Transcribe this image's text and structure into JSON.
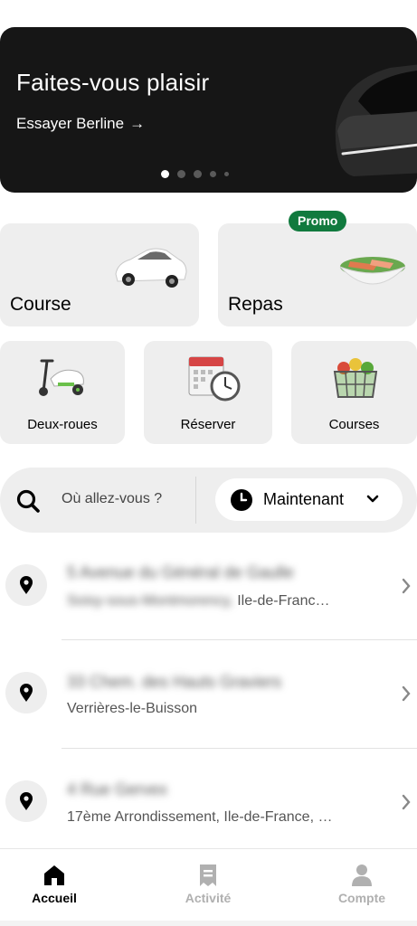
{
  "banner": {
    "title": "Faites-vous plaisir",
    "link": "Essayer Berline",
    "arrow": "→",
    "dots": 5,
    "active_dot": 0
  },
  "tiles": {
    "course": "Course",
    "repas": "Repas",
    "promo_badge": "Promo",
    "deux_roues": "Deux-roues",
    "reserver": "Réserver",
    "courses": "Courses"
  },
  "search": {
    "placeholder": "Où allez-vous ?",
    "when": "Maintenant"
  },
  "places": [
    {
      "title": "5 Avenue du Général de Gaulle",
      "sub_hidden": "Soisy-sous-Montmorency,",
      "sub_visible": " Ile-de-Franc…"
    },
    {
      "title": "33 Chem. des Hauts Graviers",
      "sub_hidden": "",
      "sub_visible": "Verrières-le-Buisson"
    },
    {
      "title": "4 Rue Gervex",
      "sub_hidden": "",
      "sub_visible": "17ème Arrondissement, Ile-de-France, …"
    }
  ],
  "nav": {
    "home": "Accueil",
    "activity": "Activité",
    "account": "Compte"
  },
  "colors": {
    "banner_bg": "#161616",
    "tile_bg": "#eeeeee",
    "promo": "#117a3e",
    "inactive": "#b0b0b0"
  }
}
